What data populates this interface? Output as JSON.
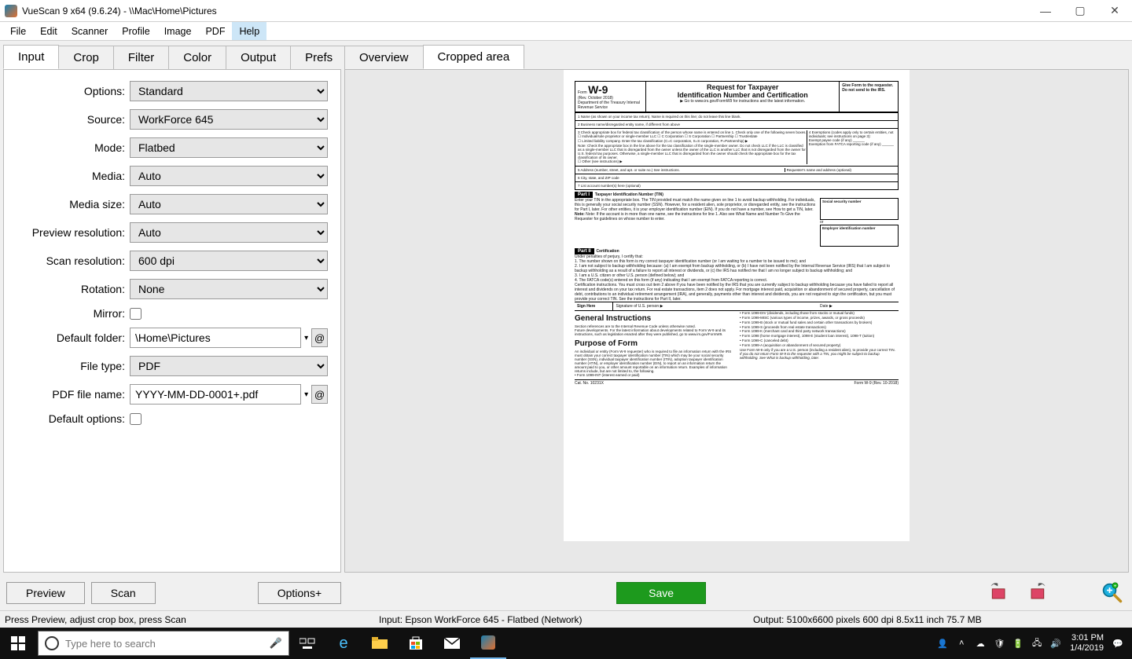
{
  "window": {
    "title": "VueScan 9 x64 (9.6.24)  -  \\\\Mac\\Home\\Pictures",
    "buttons": {
      "min": "—",
      "max": "▢",
      "close": "✕"
    }
  },
  "menu": [
    "File",
    "Edit",
    "Scanner",
    "Profile",
    "Image",
    "PDF",
    "Help"
  ],
  "menu_active_index": 6,
  "left_tabs": [
    "Input",
    "Crop",
    "Filter",
    "Color",
    "Output",
    "Prefs"
  ],
  "left_active_tab": 0,
  "right_tabs": [
    "Overview",
    "Cropped area"
  ],
  "right_active_tab": 1,
  "form": {
    "options": {
      "label": "Options:",
      "value": "Standard"
    },
    "source": {
      "label": "Source:",
      "value": "WorkForce 645"
    },
    "mode": {
      "label": "Mode:",
      "value": "Flatbed"
    },
    "media": {
      "label": "Media:",
      "value": "Auto"
    },
    "media_size": {
      "label": "Media size:",
      "value": "Auto"
    },
    "preview_res": {
      "label": "Preview resolution:",
      "value": "Auto"
    },
    "scan_res": {
      "label": "Scan resolution:",
      "value": "600 dpi"
    },
    "rotation": {
      "label": "Rotation:",
      "value": "None"
    },
    "mirror": {
      "label": "Mirror:",
      "checked": false
    },
    "default_folder": {
      "label": "Default folder:",
      "value": "\\Home\\Pictures",
      "at": "@"
    },
    "file_type": {
      "label": "File type:",
      "value": "PDF"
    },
    "pdf_file_name": {
      "label": "PDF file name:",
      "value": "YYYY-MM-DD-0001+.pdf",
      "at": "@"
    },
    "default_options": {
      "label": "Default options:",
      "checked": false
    }
  },
  "buttons": {
    "preview": "Preview",
    "scan": "Scan",
    "options": "Options+",
    "save": "Save"
  },
  "status": {
    "left": "Press Preview, adjust crop box, press Scan",
    "center": "Input: Epson WorkForce 645 - Flatbed (Network)",
    "right": "Output: 5100x6600 pixels 600 dpi 8.5x11 inch 75.7 MB"
  },
  "taskbar": {
    "search_placeholder": "Type here to search",
    "time": "3:01 PM",
    "date": "1/4/2019"
  },
  "doc": {
    "form_label": "Form",
    "form_code": "W-9",
    "rev": "(Rev. October 2018)",
    "dept": "Department of the Treasury Internal Revenue Service",
    "title1": "Request for Taxpayer",
    "title2": "Identification Number and Certification",
    "goto": "▶ Go to www.irs.gov/FormW9 for instructions and the latest information.",
    "give": "Give Form to the requester. Do not send to the IRS.",
    "line1": "1  Name (as shown on your income tax return). Name is required on this line; do not leave this line blank.",
    "line2": "2  Business name/disregarded entity name, if different from above",
    "line3": "3  Check appropriate box for federal tax classification of the person whose name is entered on line 1. Check only one of the following seven boxes.",
    "line3_opts": "☐ Individual/sole proprietor or single-member LLC    ☐ C Corporation    ☐ S Corporation    ☐ Partnership    ☐ Trust/estate",
    "line3_llc": "☐ Limited liability company. Enter the tax classification (C=C corporation, S=S corporation, P=Partnership) ▶",
    "note": "Note: Check the appropriate box in the line above for the tax classification of the single-member owner. Do not check LLC if the LLC is classified as a single-member LLC that is disregarded from the owner unless the owner of the LLC is another LLC that is not disregarded from the owner for U.S. federal tax purposes. Otherwise, a single-member LLC that is disregarded from the owner should check the appropriate box for the tax classification of its owner.",
    "line3_other": "☐ Other (see instructions) ▶",
    "line4": "4  Exemptions (codes apply only to certain entities, not individuals; see instructions on page 3):",
    "line4a": "Exempt payee code (if any) ______",
    "line4b": "Exemption from FATCA reporting code (if any) ______",
    "line5": "5  Address (number, street, and apt. or suite no.) See instructions.",
    "line5r": "Requester's name and address (optional)",
    "line6": "6  City, state, and ZIP code",
    "line7": "7  List account number(s) here (optional)",
    "part1": "Part I",
    "part1_title": "Taxpayer Identification Number (TIN)",
    "part1_body": "Enter your TIN in the appropriate box. The TIN provided must match the name given on line 1 to avoid backup withholding. For individuals, this is generally your social security number (SSN). However, for a resident alien, sole proprietor, or disregarded entity, see the instructions for Part I, later. For other entities, it is your employer identification number (EIN). If you do not have a number, see How to get a TIN, later.",
    "part1_note": "Note: If the account is in more than one name, see the instructions for line 1. Also see What Name and Number To Give the Requester for guidelines on whose number to enter.",
    "ssn_label": "Social security number",
    "or": "or",
    "ein_label": "Employer identification number",
    "part2": "Part II",
    "part2_title": "Certification",
    "cert_intro": "Under penalties of perjury, I certify that:",
    "cert1": "1. The number shown on this form is my correct taxpayer identification number (or I am waiting for a number to be issued to me); and",
    "cert2": "2. I am not subject to backup withholding because: (a) I am exempt from backup withholding, or (b) I have not been notified by the Internal Revenue Service (IRS) that I am subject to backup withholding as a result of a failure to report all interest or dividends, or (c) the IRS has notified me that I am no longer subject to backup withholding; and",
    "cert3": "3. I am a U.S. citizen or other U.S. person (defined below); and",
    "cert4": "4. The FATCA code(s) entered on this form (if any) indicating that I am exempt from FATCA reporting is correct.",
    "cert_instr": "Certification instructions. You must cross out item 2 above if you have been notified by the IRS that you are currently subject to backup withholding because you have failed to report all interest and dividends on your tax return. For real estate transactions, item 2 does not apply. For mortgage interest paid, acquisition or abandonment of secured property, cancellation of debt, contributions to an individual retirement arrangement (IRA), and generally, payments other than interest and dividends, you are not required to sign the certification, but you must provide your correct TIN. See the instructions for Part II, later.",
    "sign_here": "Sign Here",
    "signature": "Signature of U.S. person ▶",
    "date": "Date ▶",
    "gi": "General Instructions",
    "gi_body": "Section references are to the Internal Revenue Code unless otherwise noted.",
    "future": "Future developments. For the latest information about developments related to Form W-9 and its instructions, such as legislation enacted after they were published, go to www.irs.gov/FormW9.",
    "purpose": "Purpose of Form",
    "purpose_body": "An individual or entity (Form W-9 requester) who is required to file an information return with the IRS must obtain your correct taxpayer identification number (TIN) which may be your social security number (SSN), individual taxpayer identification number (ITIN), adoption taxpayer identification number (ATIN), or employer identification number (EIN), to report on an information return the amount paid to you, or other amount reportable on an information return. Examples of information returns include, but are not limited to, the following.",
    "bul_int": "Form 1099-INT (interest earned or paid)",
    "right_bullets": [
      "Form 1099-DIV (dividends, including those from stocks or mutual funds)",
      "Form 1099-MISC (various types of income, prizes, awards, or gross proceeds)",
      "Form 1099-B (stock or mutual fund sales and certain other transactions by brokers)",
      "Form 1099-S (proceeds from real estate transactions)",
      "Form 1099-K (merchant card and third party network transactions)",
      "Form 1098 (home mortgage interest), 1098-E (student loan interest), 1098-T (tuition)",
      "Form 1099-C (canceled debt)",
      "Form 1099-A (acquisition or abandonment of secured property)"
    ],
    "use_w9": "Use Form W-9 only if you are a U.S. person (including a resident alien), to provide your correct TIN.",
    "ifnot": "If you do not return Form W-9 to the requester with a TIN, you might be subject to backup withholding. See What is backup withholding, later.",
    "catno": "Cat. No. 10231X",
    "footer": "Form W-9 (Rev. 10-2018)"
  }
}
